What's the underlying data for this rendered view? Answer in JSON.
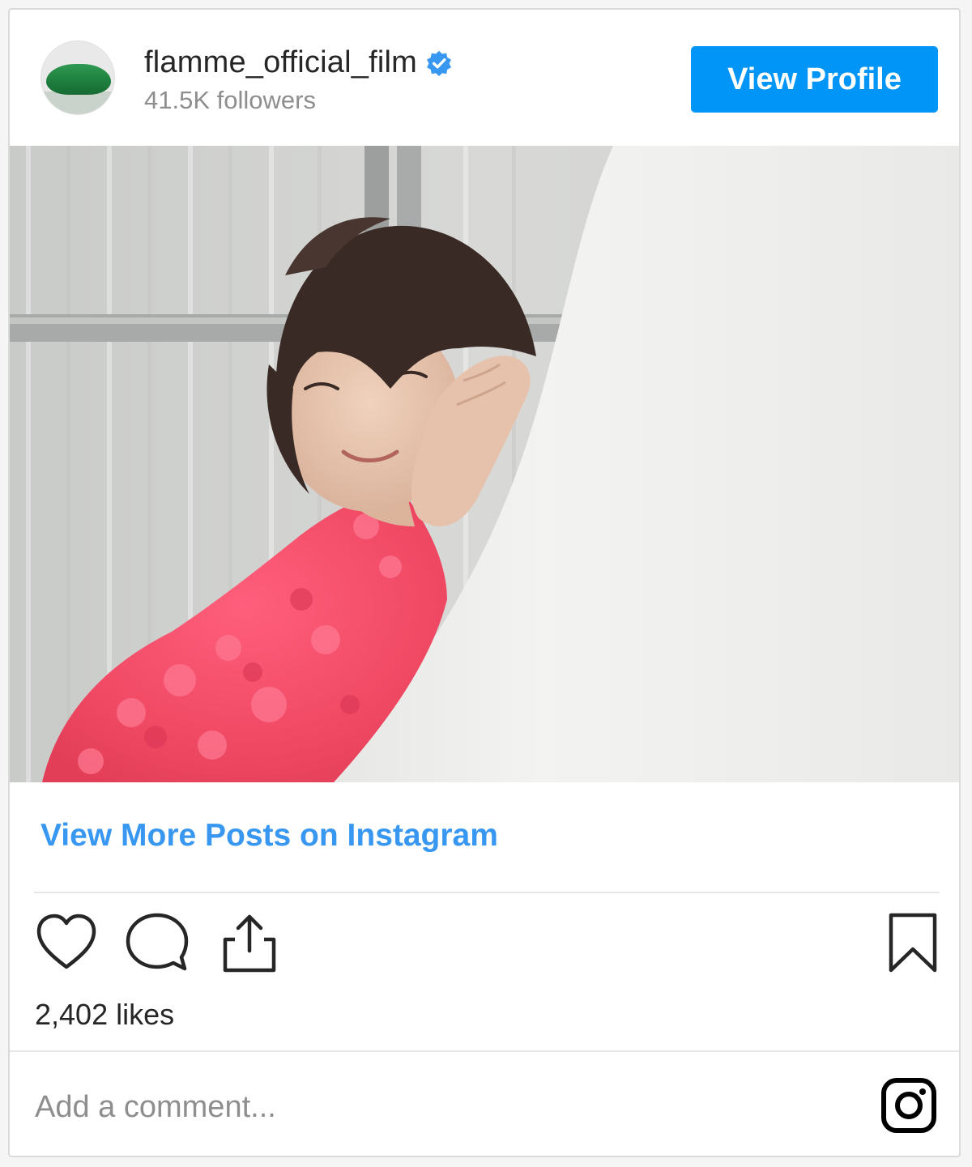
{
  "header": {
    "username": "flamme_official_film",
    "followers": "41.5K followers",
    "view_profile_label": "View Profile",
    "verified_icon": "verified-badge-icon",
    "accent_color": "#0095f6"
  },
  "post": {
    "image_description_icon": "post-photo",
    "view_more_label": "View More Posts on Instagram",
    "likes": "2,402 likes"
  },
  "actions": {
    "icons": [
      "heart-icon",
      "comment-icon",
      "share-icon",
      "bookmark-icon"
    ]
  },
  "comment": {
    "placeholder": "Add a comment...",
    "brand_icon": "instagram-icon"
  }
}
